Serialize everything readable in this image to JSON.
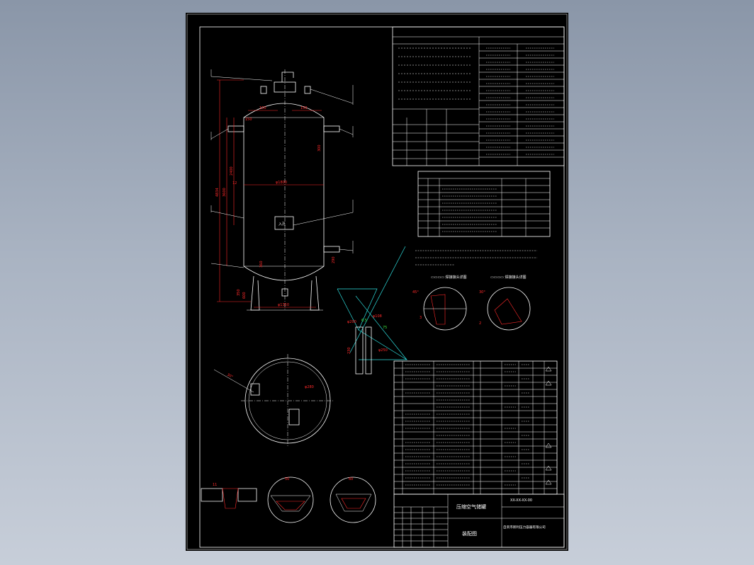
{
  "drawing": {
    "dims": {
      "d1": "φ1800",
      "d2": "φ1350",
      "h1": "4834",
      "h2": "3600",
      "h3": "2400",
      "h4": "350",
      "h5": "150",
      "h6": "150",
      "h7": "150",
      "h8": "300",
      "h9": "360",
      "h10": "600",
      "h11": "290",
      "h12": "12",
      "h13": "5",
      "h14": "φ250",
      "h15": "230",
      "d3": "φ280",
      "d4": "φ1350",
      "w1": "30°",
      "w2": "60°",
      "w3": "6.5",
      "w4": "75",
      "w5": "45°",
      "w6": "3",
      "w7": "φ200",
      "w8": "φ108",
      "w9": "11",
      "w10": "2",
      "w11": "50",
      "w12": "60"
    },
    "manhole": "入孔"
  },
  "title_block": {
    "name": "压缩空气储罐",
    "sub": "装配图",
    "drawing_no": "XX-XX-XX-00",
    "company": "自贡市新利压力容器有限公司"
  },
  "colors": {
    "sheet": "#000000",
    "outline": "#ffffff",
    "dimension": "#ff2a2a",
    "section": "#2ee0e0",
    "weld": "#3ce03c"
  }
}
